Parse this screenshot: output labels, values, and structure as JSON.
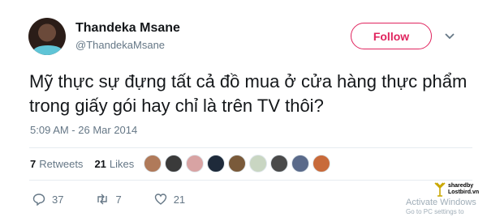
{
  "user": {
    "name": "Thandeka Msane",
    "handle": "@ThandekaMsane"
  },
  "follow_label": "Follow",
  "tweet": {
    "text_line1": "Mỹ thực sự đựng tất cả đồ mua ở cửa hàng thực phẩm",
    "text_line2": "trong giấy gói hay chỉ là trên TV thôi?",
    "timestamp": "5:09 AM - 26 Mar 2014"
  },
  "stats": {
    "retweets_count": "7",
    "retweets_label": "Retweets",
    "likes_count": "21",
    "likes_label": "Likes"
  },
  "likers": [
    "#b07a5a",
    "#3a3a3a",
    "#d8a3a3",
    "#1e2a3a",
    "#7a5a3a",
    "#c9d6c2",
    "#4a4a4a",
    "#5a6a8a",
    "#c86a3a"
  ],
  "actions": {
    "reply_count": "37",
    "retweet_count": "7",
    "like_count": "21"
  },
  "watermark": {
    "line1": "Activate Windows",
    "line2": "Go to PC settings to activate",
    "logo_line1": "sharedby",
    "logo_line2": "Lostbird.vn"
  },
  "colors": {
    "follow": "#e0245e",
    "muted": "#657786",
    "text": "#14171a"
  }
}
